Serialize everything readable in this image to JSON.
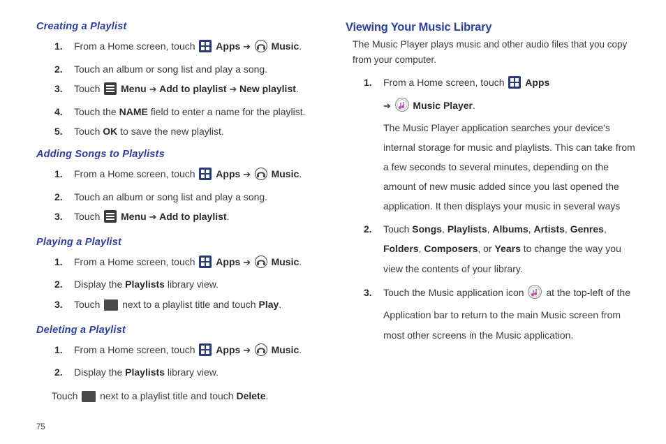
{
  "left": {
    "creating": {
      "title": "Creating a Playlist",
      "s1a": "From a Home screen, touch ",
      "s1_apps": "Apps",
      "s1_arrow": " ➔ ",
      "s1_music": "Music",
      "s1_end": ".",
      "s2": "Touch an album or song list and play a song.",
      "s3a": "Touch ",
      "s3_menu": "Menu",
      "s3_arrow1": "  ➔ ",
      "s3_add": "Add to playlist",
      "s3_arrow2": " ➔ ",
      "s3_new": "New playlist",
      "s3_end": ".",
      "s4a": "Touch the ",
      "s4_name": "NAME",
      "s4b": " field to enter a name for the playlist.",
      "s5a": "Touch ",
      "s5_ok": "OK",
      "s5b": " to save the new playlist."
    },
    "adding": {
      "title": "Adding Songs to Playlists",
      "s1a": "From a Home screen, touch ",
      "s1_apps": "Apps",
      "s1_arrow": " ➔ ",
      "s1_music": "Music",
      "s1_end": ".",
      "s2": "Touch an album or song list and play a song.",
      "s3a": "Touch ",
      "s3_menu": "Menu",
      "s3_arrow1": "  ➔ ",
      "s3_add": "Add to playlist",
      "s3_end": "."
    },
    "playing": {
      "title": "Playing a Playlist",
      "s1a": "From a Home screen, touch ",
      "s1_apps": "Apps",
      "s1_arrow": " ➔ ",
      "s1_music": "Music",
      "s1_end": ".",
      "s2a": "Display the ",
      "s2_pl": "Playlists",
      "s2b": " library view.",
      "s3a": "Touch ",
      "s3b": " next to a playlist title and touch ",
      "s3_play": "Play",
      "s3_end": "."
    },
    "deleting": {
      "title": "Deleting a Playlist",
      "s1a": "From a Home screen, touch ",
      "s1_apps": "Apps",
      "s1_arrow": " ➔ ",
      "s1_music": "Music",
      "s1_end": ".",
      "s2a": "Display the ",
      "s2_pl": "Playlists",
      "s2b": " library view.",
      "s3a": "Touch ",
      "s3b": " next to a playlist title and touch ",
      "s3_del": "Delete",
      "s3_end": "."
    },
    "page": "75"
  },
  "right": {
    "title": "Viewing Your Music Library",
    "intro_a": "The Music Player plays ",
    "intro_b": "music and other audio files that you copy from your computer.",
    "s1a": "From a Home screen, touch ",
    "s1_apps": "Apps",
    "s1_arrow": "➔ ",
    "s1_mp": "Music Player",
    "s1_end": ".",
    "s1_para": "The Music Player application searches your device's internal storage for music and playlists. This can take from a few seconds to several minutes, depending on the amount of new music added since you last opened the application. It then displays your music in several ways",
    "s2a": "Touch ",
    "s2_songs": "Songs",
    "s2_c1": ", ",
    "s2_playlists": "Playlists",
    "s2_c2": ", ",
    "s2_albums": "Albums",
    "s2_c3": ", ",
    "s2_artists": "Artists",
    "s2_c4": ", ",
    "s2_genres": "Genres",
    "s2_c5": ", ",
    "s2_folders": "Folders",
    "s2_c6": ", ",
    "s2_composers": "Composers",
    "s2_or": ", or ",
    "s2_years": "Years",
    "s2b": " to change the way you view the contents of your library.",
    "s3a": "Touch the Music application icon ",
    "s3b": " at the top-left of the Application bar to return to the main Music screen from most other screens in the Music application."
  }
}
